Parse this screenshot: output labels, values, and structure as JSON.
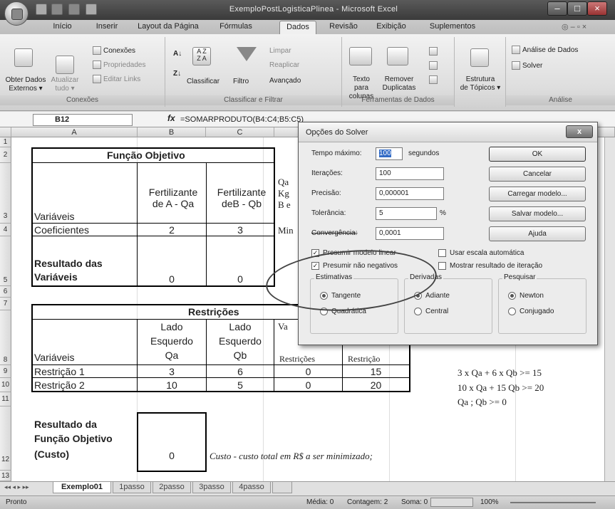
{
  "app": {
    "title": "ExemploPostLogisticaPlinea - Microsoft Excel"
  },
  "tabs": [
    "Início",
    "Inserir",
    "Layout da Página",
    "Fórmulas",
    "Dados",
    "Revisão",
    "Exibição",
    "Suplementos"
  ],
  "ribbon": {
    "obter": "Obter Dados",
    "externos": "Externos ▾",
    "atualizar": "Atualizar",
    "tudo": "tudo ▾",
    "conexoes_btn": "Conexões",
    "propriedades": "Propriedades",
    "editar_links": "Editar Links",
    "conexoes_label": "Conexões",
    "classificar": "Classificar",
    "filtro": "Filtro",
    "limpar": "Limpar",
    "reaplicar": "Reaplicar",
    "avancado": "Avançado",
    "classificar_label": "Classificar e Filtrar",
    "texto_para": "Texto para",
    "colunas": "colunas",
    "remover": "Remover",
    "duplicatas": "Duplicatas",
    "ferramentas_label": "Ferramentas de Dados",
    "estrutura": "Estrutura",
    "de_topicos": "de Tópicos ▾",
    "analise_dados": "Análise de Dados",
    "solver": "Solver",
    "analise_label": "Análise"
  },
  "formula_bar": {
    "name": "B12",
    "formula": "=SOMARPRODUTO(B4:C4;B5:C5)"
  },
  "columns": [
    "A",
    "B",
    "C"
  ],
  "rows": [
    "1",
    "2",
    "3",
    "4",
    "5",
    "6",
    "7",
    "8",
    "9",
    "10",
    "11",
    "12",
    "13"
  ],
  "sheet": {
    "funcao_objetivo": "Função Objetivo",
    "variaveis": "Variáveis",
    "fert_a1": "Fertilizante",
    "fert_a2": "de A - Qa",
    "fert_b1": "Fertilizante",
    "fert_b2": "deB - Qb",
    "d_partial": [
      "Qa",
      "Kg",
      "B e",
      "Min"
    ],
    "coeficientes": "Coeficientes",
    "coef_a": "2",
    "coef_b": "3",
    "resultado1": "Resultado das",
    "resultado2": "Variáveis",
    "res_a": "0",
    "res_b": "0",
    "restricoes": "Restrições",
    "lado1": "Lado",
    "esquerdo": "Esquerdo",
    "lado_qa": "Qa",
    "lado_qb": "Qb",
    "d_hdr": "Va",
    "d_hdr2": "Restrições",
    "e_hdr2": "Restrição",
    "restricao1": "Restrição 1",
    "r1": [
      "3",
      "6",
      "0",
      "15"
    ],
    "restricao2": "Restrição 2",
    "r2": [
      "10",
      "5",
      "0",
      "20"
    ],
    "note1": "3 x Qa + 6 x Qb >= 15",
    "note2": "10 x Qa + 15 Qb >= 20",
    "note3": "Qa ; Qb >= 0",
    "resultado_fo1": "Resultado da",
    "resultado_fo2": "Função Objetivo",
    "resultado_fo3": "(Custo)",
    "fo_val": "0",
    "custo_note": "Custo - custo total em R$ a ser minimizado;"
  },
  "sheet_tabs": [
    "Exemplo01",
    "1passo",
    "2passo",
    "3passo",
    "4passo"
  ],
  "status": {
    "ready": "Pronto",
    "media": "Média: 0",
    "contagem": "Contagem: 2",
    "soma": "Soma: 0",
    "zoom": "100%"
  },
  "dialog": {
    "title": "Opções do Solver",
    "tempo_label": "Tempo máximo:",
    "tempo_val": "100",
    "segundos": "segundos",
    "iter_label": "Iterações:",
    "iter_val": "100",
    "prec_label": "Precisão:",
    "prec_val": "0,000001",
    "tol_label": "Tolerância:",
    "tol_val": "5",
    "pct": "%",
    "conv_label": "Convergência:",
    "conv_val": "0,0001",
    "ok": "OK",
    "cancelar": "Cancelar",
    "carregar": "Carregar modelo...",
    "salvar": "Salvar modelo...",
    "ajuda": "Ajuda",
    "linear": "Presumir modelo linear",
    "nao_neg": "Presumir não negativos",
    "escala": "Usar escala automática",
    "mostrar": "Mostrar resultado de iteração",
    "estimativas": "Estimativas",
    "tangente": "Tangente",
    "quadratica": "Quadrática",
    "derivadas": "Derivadas",
    "adiante": "Adiante",
    "central": "Central",
    "pesquisar": "Pesquisar",
    "newton": "Newton",
    "conjugado": "Conjugado"
  }
}
